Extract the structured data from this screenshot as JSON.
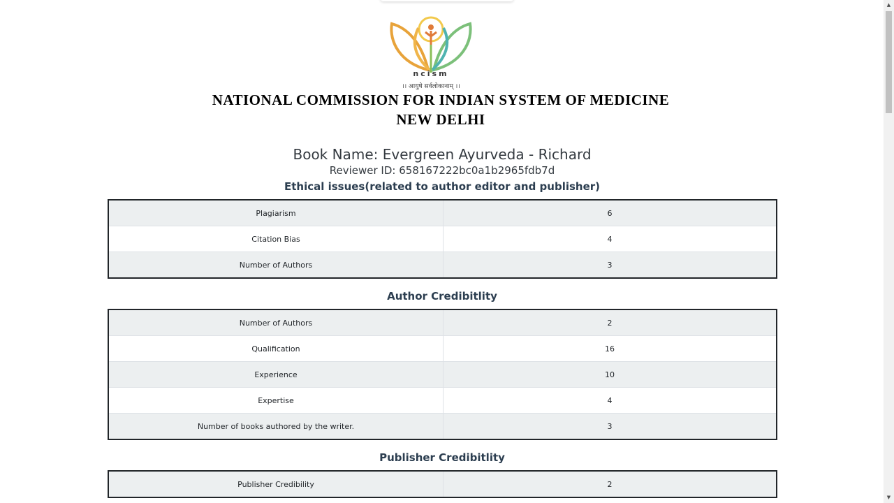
{
  "logo": {
    "wordmark": "ncism",
    "motto": "।। आयुषे सर्वलोकानाम् ।।"
  },
  "organization": {
    "line1": "NATIONAL COMMISSION FOR INDIAN SYSTEM OF MEDICINE",
    "line2": "NEW DELHI"
  },
  "book_name": "Book Name: Evergreen Ayurveda - Richard",
  "reviewer_id": "Reviewer ID: 658167222bc0a1b2965fdb7d",
  "sections": [
    {
      "title": "Ethical issues(related to author editor and publisher)",
      "rows": [
        {
          "label": "Plagiarism",
          "value": "6"
        },
        {
          "label": "Citation Bias",
          "value": "4"
        },
        {
          "label": "Number of Authors",
          "value": "3"
        }
      ]
    },
    {
      "title": "Author Credibitlity",
      "rows": [
        {
          "label": "Number of Authors",
          "value": "2"
        },
        {
          "label": "Qualification",
          "value": "16"
        },
        {
          "label": "Experience",
          "value": "10"
        },
        {
          "label": "Expertise",
          "value": "4"
        },
        {
          "label": "Number of books authored by the writer.",
          "value": "3"
        }
      ]
    },
    {
      "title": "Publisher Credibitlity",
      "rows": [
        {
          "label": "Publisher Credibility",
          "value": "2"
        }
      ]
    }
  ],
  "colors": {
    "row_shaded": "#eceff0",
    "row_plain": "#ffffff",
    "table_border": "#212529",
    "heading": "#2c3e50"
  }
}
